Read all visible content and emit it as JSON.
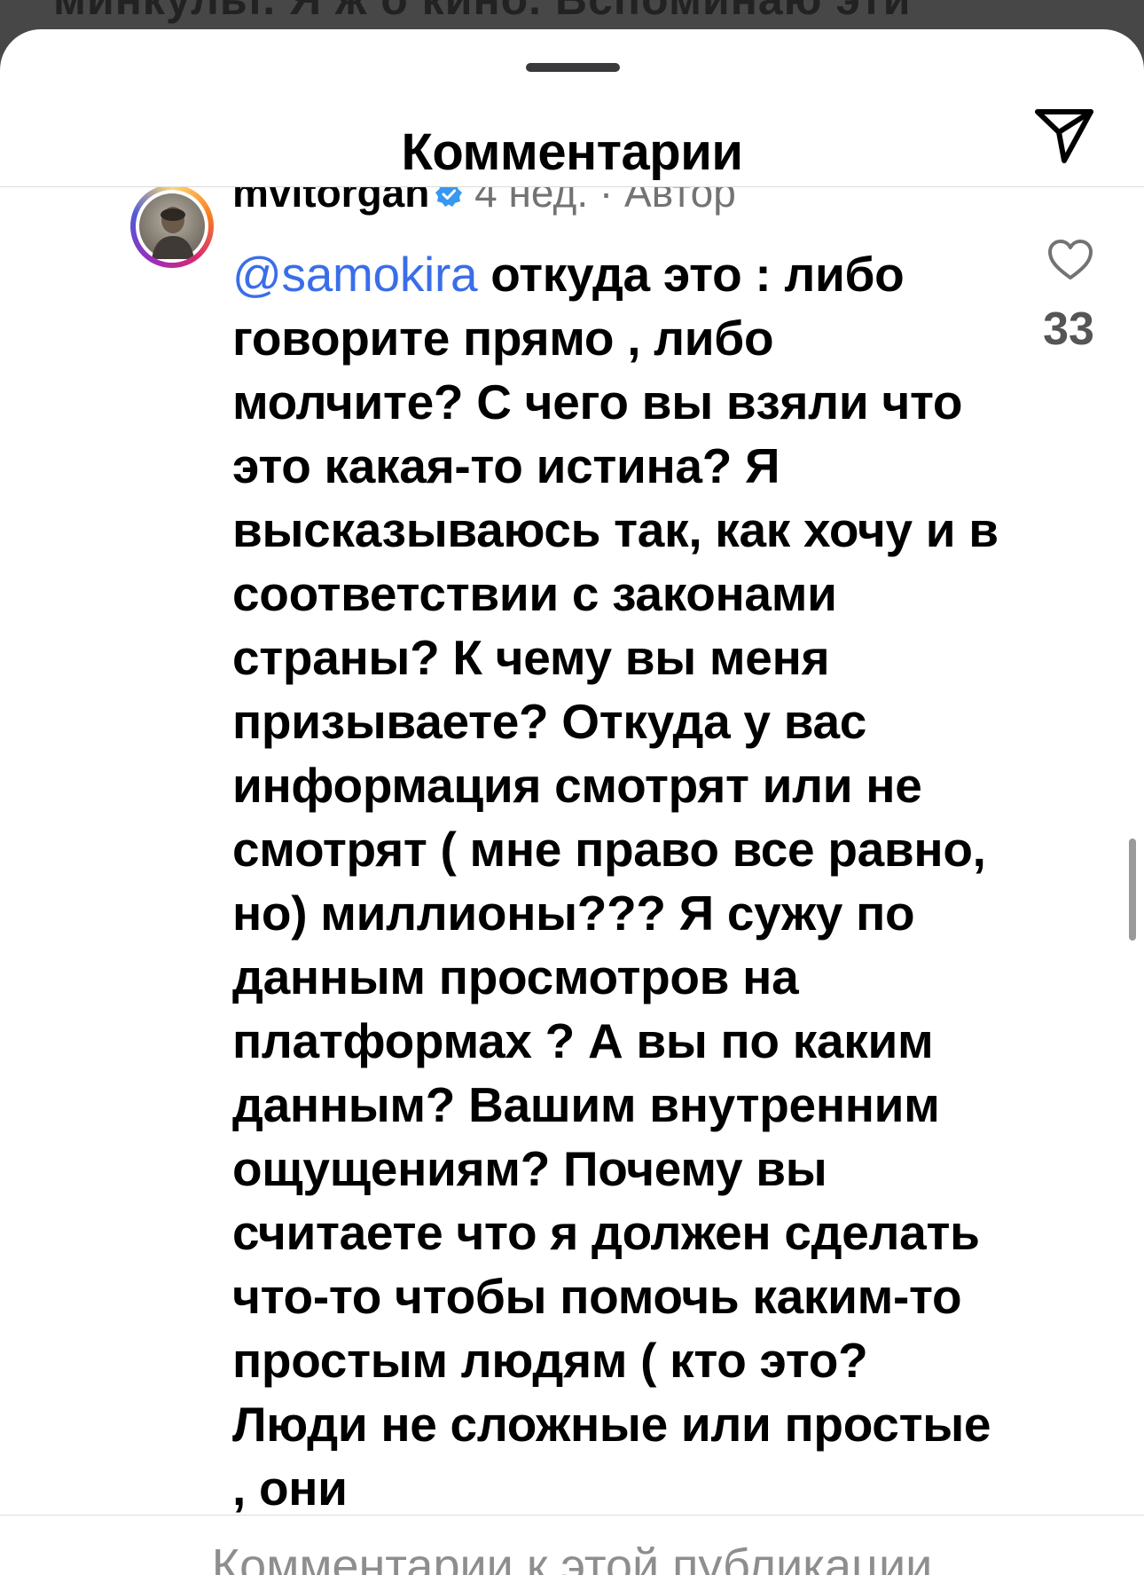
{
  "background": {
    "partial_text": "минкульт. Я ж о кино. Вспоминаю эти"
  },
  "sheet": {
    "title": "Комментарии"
  },
  "comment": {
    "username": "mvitorgan",
    "time": "4 нед.",
    "separator": "·",
    "author_label": "Автор",
    "mention": "@samokira",
    "text": " откуда это : либо говорите прямо , либо молчите? С чего вы взяли что это какая-то истина? Я высказываюсь так, как хочу и в соответствии с законами страны? К чему вы меня призываете? Откуда у вас информация смотрят или не смотрят ( мне право все равно, но) миллионы??? Я сужу по данным просмотров на платформах ? А вы по каким данным? Вашим внутренним ощущениям? Почему вы считаете что я должен сделать что-то чтобы помочь каким-то простым людям ( кто это? Люди не сложные или простые , они",
    "likes": "33"
  },
  "footer": {
    "placeholder": "Комментарии к этой публикации"
  },
  "icons": {
    "share": "paper-plane-icon",
    "like": "heart-icon",
    "verified": "verified-badge-icon"
  },
  "colors": {
    "mention": "#3a6ee8",
    "verified": "#3897f0",
    "secondary_text": "#737373"
  }
}
